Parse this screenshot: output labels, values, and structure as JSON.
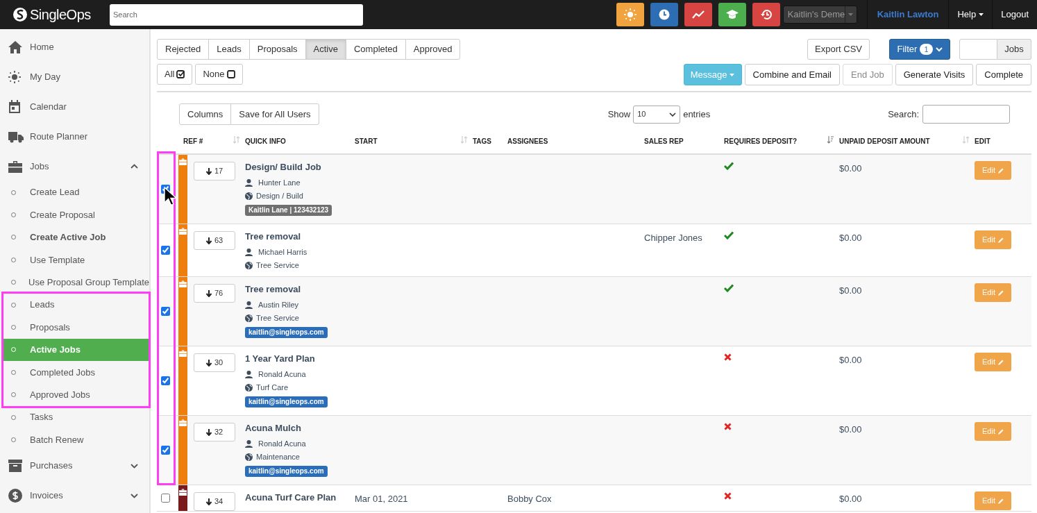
{
  "topbar": {
    "logo": "SingleOps",
    "search_placeholder": "Search",
    "quick_buttons": [
      {
        "kind": "sun",
        "color": "#f0a33e"
      },
      {
        "kind": "clock",
        "color": "#2c6db3"
      },
      {
        "kind": "trend",
        "color": "#d64541"
      },
      {
        "kind": "cap",
        "color": "#4cae4c"
      },
      {
        "kind": "history",
        "color": "#d64541"
      }
    ],
    "account": "Kaitlin's Deme",
    "user": "Kaitlin Lawton",
    "help": "Help",
    "logout": "Logout"
  },
  "sidebar": {
    "items": [
      {
        "kind": "section",
        "label": "Home",
        "selected": false
      },
      {
        "kind": "section",
        "label": "My Day",
        "selected": false
      },
      {
        "kind": "section",
        "label": "Calendar",
        "selected": false
      },
      {
        "kind": "section",
        "label": "Route Planner",
        "selected": false
      },
      {
        "kind": "section",
        "label": "Jobs",
        "selected": false,
        "expanded": true
      },
      {
        "kind": "sub",
        "label": "Create Lead",
        "selected": false,
        "highlighted": false,
        "emphasized": false
      },
      {
        "kind": "sub",
        "label": "Create Proposal",
        "selected": false,
        "highlighted": false,
        "emphasized": false
      },
      {
        "kind": "sub",
        "label": "Create Active Job",
        "selected": false,
        "highlighted": false,
        "emphasized": true
      },
      {
        "kind": "sub",
        "label": "Use Template",
        "selected": false,
        "highlighted": false,
        "emphasized": false
      },
      {
        "kind": "sub",
        "label": "Use Proposal Group Template",
        "selected": false,
        "highlighted": false,
        "emphasized": false
      },
      {
        "kind": "sub",
        "label": "Leads",
        "selected": false,
        "highlighted": true,
        "emphasized": false
      },
      {
        "kind": "sub",
        "label": "Proposals",
        "selected": false,
        "highlighted": true,
        "emphasized": false
      },
      {
        "kind": "sub",
        "label": "Active Jobs",
        "selected": true,
        "highlighted": true,
        "emphasized": false
      },
      {
        "kind": "sub",
        "label": "Completed Jobs",
        "selected": false,
        "highlighted": true,
        "emphasized": false
      },
      {
        "kind": "sub",
        "label": "Approved Jobs",
        "selected": false,
        "highlighted": true,
        "emphasized": false
      },
      {
        "kind": "sub",
        "label": "Tasks",
        "selected": false,
        "highlighted": false,
        "emphasized": false
      },
      {
        "kind": "sub",
        "label": "Batch Renew",
        "selected": false,
        "highlighted": false,
        "emphasized": false
      },
      {
        "kind": "section",
        "label": "Purchases",
        "selected": false,
        "expanded": false
      },
      {
        "kind": "section",
        "label": "Invoices",
        "selected": false,
        "expanded": false
      }
    ]
  },
  "status_tabs": [
    {
      "label": "Rejected",
      "selected": false
    },
    {
      "label": "Leads",
      "selected": false
    },
    {
      "label": "Proposals",
      "selected": false
    },
    {
      "label": "Active",
      "selected": true
    },
    {
      "label": "Completed",
      "selected": false
    },
    {
      "label": "Approved",
      "selected": false
    }
  ],
  "select_buttons": [
    {
      "kind": "all",
      "label": "All"
    },
    {
      "kind": "none",
      "label": "None"
    }
  ],
  "export_button": "Export CSV",
  "filter_button": {
    "label": "Filter",
    "count": "1"
  },
  "jobs_field": {
    "addon": "Jobs"
  },
  "bulk_actions": [
    {
      "label": "Message",
      "kind": "dropdown",
      "disabled": false
    },
    {
      "label": "Combine and Email",
      "kind": "plain",
      "disabled": false
    },
    {
      "label": "End Job",
      "kind": "plain",
      "disabled": true
    },
    {
      "label": "Generate Visits",
      "kind": "plain",
      "disabled": false
    },
    {
      "label": "Complete",
      "kind": "plain",
      "disabled": false
    }
  ],
  "table_tools": {
    "column_buttons": [
      "Columns",
      "Save for All Users"
    ],
    "show_label": "Show",
    "page_size": "10",
    "entries_label": "entries",
    "search_label": "Search:"
  },
  "table": {
    "columns": [
      {
        "label": "REF #",
        "sortable": true,
        "sorted": false
      },
      {
        "label": "QUICK INFO",
        "sortable": false,
        "sorted": false
      },
      {
        "label": "START",
        "sortable": true,
        "sorted": false
      },
      {
        "label": "TAGS",
        "sortable": false,
        "sorted": false
      },
      {
        "label": "ASSIGNEES",
        "sortable": false,
        "sorted": false
      },
      {
        "label": "SALES REP",
        "sortable": false,
        "sorted": false
      },
      {
        "label": "REQUIRES DEPOSIT?",
        "sortable": true,
        "sorted": true
      },
      {
        "label": "UNPAID DEPOSIT AMOUNT",
        "sortable": true,
        "sorted": false
      },
      {
        "label": "EDIT",
        "sortable": false,
        "sorted": false
      }
    ],
    "rows": [
      {
        "checked": true,
        "color": "#ee7f0f",
        "ref": "17",
        "title": "Design/ Build Job",
        "customer": "Hunter Lane",
        "service": "Design / Build",
        "badge": {
          "text": "Kaitlin Lane | 123432123",
          "color": "#6f6f6f"
        },
        "requires_deposit": true,
        "unpaid": "$0.00",
        "edit": "Edit"
      },
      {
        "checked": true,
        "color": "#ee7f0f",
        "ref": "63",
        "title": "Tree removal",
        "customer": "Michael Harris",
        "service": "Tree Service",
        "sales_rep": "Chipper Jones",
        "requires_deposit": true,
        "unpaid": "$0.00",
        "edit": "Edit"
      },
      {
        "checked": true,
        "color": "#ee7f0f",
        "ref": "76",
        "title": "Tree removal",
        "customer": "Austin Riley",
        "service": "Tree Service",
        "badge": {
          "text": "kaitlin@singleops.com",
          "color": "#2a6ebb"
        },
        "requires_deposit": true,
        "unpaid": "$0.00",
        "edit": "Edit"
      },
      {
        "checked": true,
        "color": "#ee7f0f",
        "ref": "30",
        "title": "1 Year Yard Plan",
        "customer": "Ronald Acuna",
        "service": "Turf Care",
        "badge": {
          "text": "kaitlin@singleops.com",
          "color": "#2a6ebb"
        },
        "requires_deposit": false,
        "unpaid": "$0.00",
        "edit": "Edit"
      },
      {
        "checked": true,
        "color": "#ee7f0f",
        "ref": "32",
        "title": "Acuna Mulch",
        "customer": "Ronald Acuna",
        "service": "Maintenance",
        "badge": {
          "text": "kaitlin@singleops.com",
          "color": "#2a6ebb"
        },
        "requires_deposit": false,
        "unpaid": "$0.00",
        "edit": "Edit"
      },
      {
        "checked": false,
        "color": "#7b1a1a",
        "ref": "34",
        "title": "Acuna Turf Care Plan",
        "start": "Mar 01, 2021",
        "assignees": "Bobby Cox",
        "requires_deposit": false,
        "unpaid": "$0.00",
        "edit": "Edit"
      }
    ]
  },
  "annotations": {
    "checkbox_column_box": true,
    "pointer": true
  }
}
